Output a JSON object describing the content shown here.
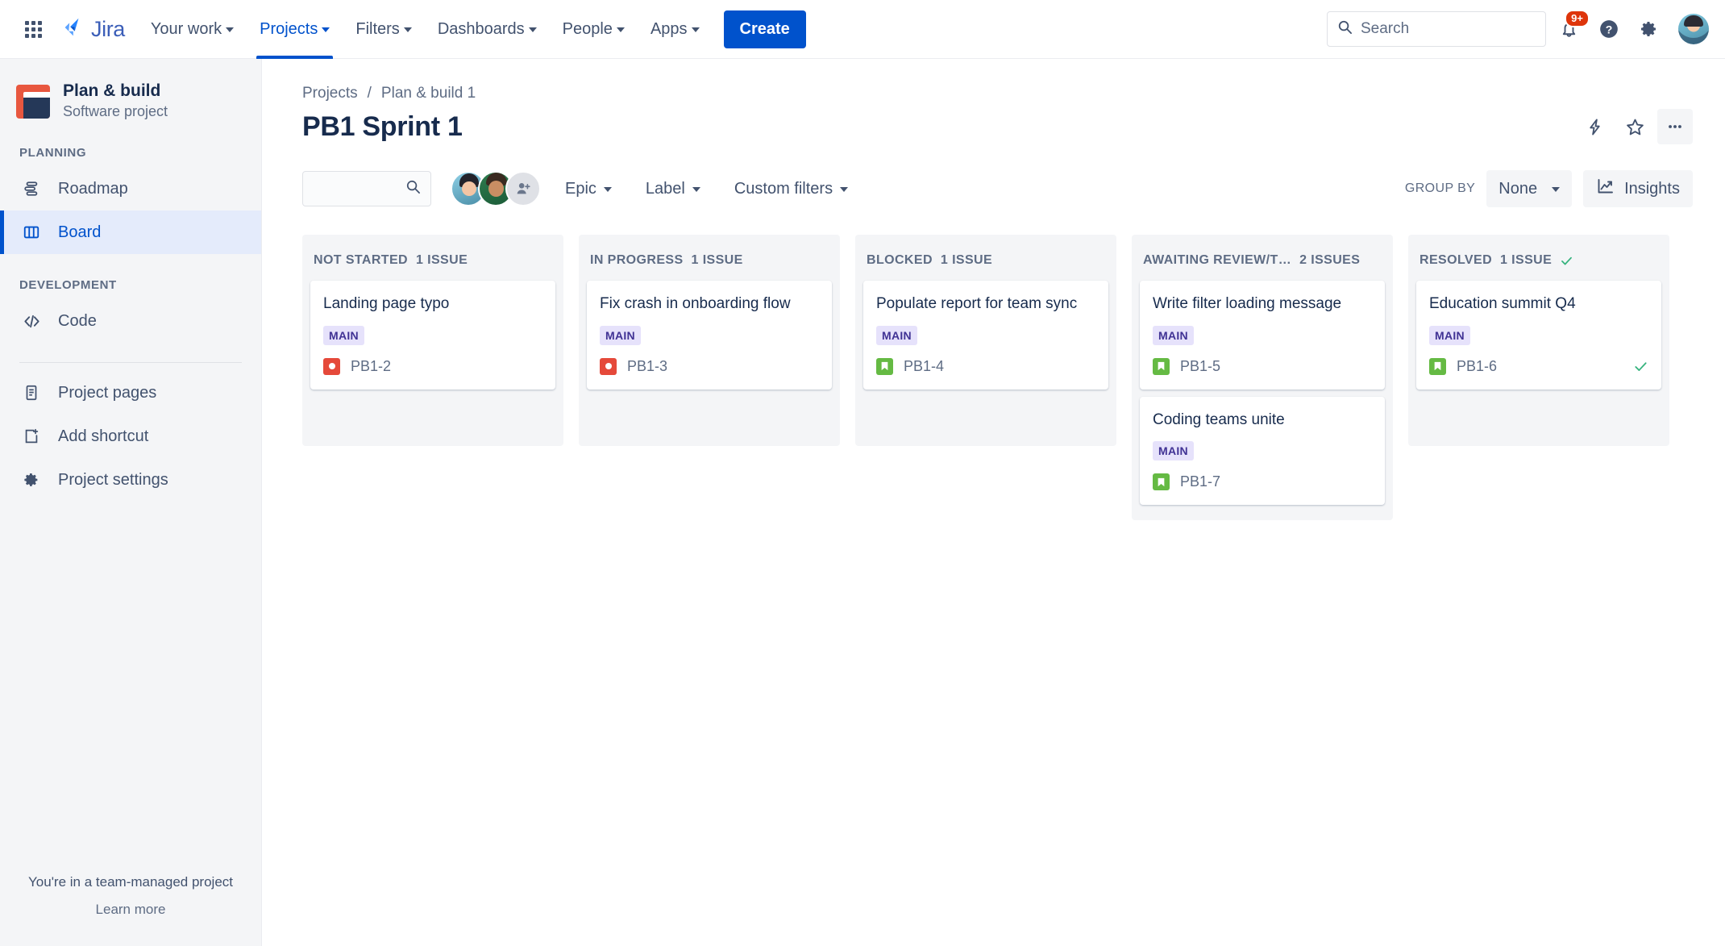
{
  "topnav": {
    "app_switcher_icon": "grid-apps-icon",
    "brand": "Jira",
    "items": [
      {
        "label": "Your work",
        "has_caret": true,
        "active": false
      },
      {
        "label": "Projects",
        "has_caret": true,
        "active": true
      },
      {
        "label": "Filters",
        "has_caret": true,
        "active": false
      },
      {
        "label": "Dashboards",
        "has_caret": true,
        "active": false
      },
      {
        "label": "People",
        "has_caret": true,
        "active": false
      },
      {
        "label": "Apps",
        "has_caret": true,
        "active": false
      }
    ],
    "create_label": "Create",
    "search": {
      "placeholder": "Search",
      "value": "",
      "icon": "search-icon"
    },
    "notifications": {
      "icon": "bell-icon",
      "badge": "9+"
    },
    "help_icon": "help-circle-icon",
    "settings_icon": "gear-icon",
    "profile_avatar": "user-avatar"
  },
  "sidebar": {
    "project": {
      "name": "Plan & build",
      "type": "Software project",
      "icon": "project-avatar"
    },
    "sections": [
      {
        "title": "PLANNING",
        "items": [
          {
            "label": "Roadmap",
            "icon": "roadmap-icon",
            "active": false
          },
          {
            "label": "Board",
            "icon": "board-columns-icon",
            "active": true
          }
        ]
      },
      {
        "title": "DEVELOPMENT",
        "items": [
          {
            "label": "Code",
            "icon": "code-brackets-icon",
            "active": false
          }
        ]
      }
    ],
    "extra_items": [
      {
        "label": "Project pages",
        "icon": "page-document-icon"
      },
      {
        "label": "Add shortcut",
        "icon": "add-shortcut-icon"
      },
      {
        "label": "Project settings",
        "icon": "gear-icon"
      }
    ],
    "footer": {
      "note": "You're in a team-managed project",
      "link": "Learn more"
    }
  },
  "main": {
    "breadcrumb": [
      "Projects",
      "Plan & build 1"
    ],
    "breadcrumb_separator": "/",
    "title": "PB1 Sprint 1",
    "title_actions": [
      {
        "name": "automation-bolt-icon",
        "icon": "lightning-bolt-icon"
      },
      {
        "name": "star-favorite-icon",
        "icon": "star-icon"
      },
      {
        "name": "more-actions-button",
        "icon": "ellipsis-icon"
      }
    ],
    "toolbar": {
      "search": {
        "placeholder": "",
        "value": "",
        "icon": "search-icon"
      },
      "avatars": [
        "member-avatar-1",
        "member-avatar-2"
      ],
      "add_people_label": "add-people-icon",
      "filters": [
        {
          "label": "Epic",
          "caret": true
        },
        {
          "label": "Label",
          "caret": true
        },
        {
          "label": "Custom filters",
          "caret": true
        }
      ],
      "group_by_label": "GROUP BY",
      "group_by_value": "None",
      "insights_label": "Insights",
      "insights_icon": "insights-chart-icon"
    },
    "columns": [
      {
        "name": "NOT STARTED",
        "count": "1 ISSUE",
        "done": false,
        "cards": [
          {
            "title": "Landing page typo",
            "lozenge": "MAIN",
            "key": "PB1-2",
            "type": "bug",
            "done": false
          }
        ]
      },
      {
        "name": "IN PROGRESS",
        "count": "1 ISSUE",
        "done": false,
        "cards": [
          {
            "title": "Fix crash in onboarding flow",
            "lozenge": "MAIN",
            "key": "PB1-3",
            "type": "bug",
            "done": false
          }
        ]
      },
      {
        "name": "BLOCKED",
        "count": "1 ISSUE",
        "done": false,
        "cards": [
          {
            "title": "Populate report for team sync",
            "lozenge": "MAIN",
            "key": "PB1-4",
            "type": "story",
            "done": false
          }
        ]
      },
      {
        "name": "AWAITING REVIEW/T…",
        "count": "2 ISSUES",
        "done": false,
        "cards": [
          {
            "title": "Write filter loading message",
            "lozenge": "MAIN",
            "key": "PB1-5",
            "type": "story",
            "done": false
          },
          {
            "title": "Coding teams unite",
            "lozenge": "MAIN",
            "key": "PB1-7",
            "type": "story",
            "done": false
          }
        ]
      },
      {
        "name": "RESOLVED",
        "count": "1 ISSUE",
        "done": true,
        "cards": [
          {
            "title": "Education summit Q4",
            "lozenge": "MAIN",
            "key": "PB1-6",
            "type": "story",
            "done": true
          }
        ]
      }
    ]
  },
  "colors": {
    "brand_blue": "#0052CC",
    "bug_red": "#E5493A",
    "story_green": "#65BA43",
    "lozenge_purple_bg": "#E6E2FB",
    "lozenge_purple_text": "#403294",
    "done_green": "#36B37E",
    "badge_red": "#DE350B",
    "sidebar_bg": "#F4F5F7"
  }
}
